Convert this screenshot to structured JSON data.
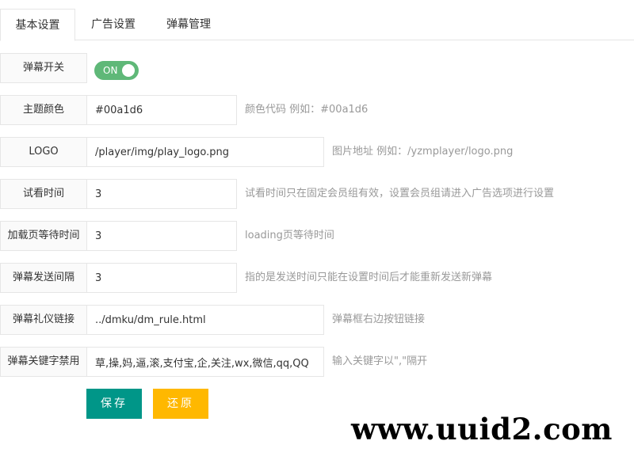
{
  "tabs": [
    {
      "label": "基本设置",
      "active": true
    },
    {
      "label": "广告设置",
      "active": false
    },
    {
      "label": "弹幕管理",
      "active": false
    }
  ],
  "form": {
    "danmaku_switch": {
      "label": "弹幕开关",
      "state_text": "ON",
      "on": true,
      "color": "#5fb878"
    },
    "theme_color": {
      "label": "主题颜色",
      "value": "#00a1d6",
      "hint": "颜色代码 例如：#00a1d6"
    },
    "logo": {
      "label": "LOGO",
      "value": "/player/img/play_logo.png",
      "hint": "图片地址 例如：/yzmplayer/logo.png"
    },
    "trial_time": {
      "label": "试看时间",
      "value": "3",
      "hint": "试看时间只在固定会员组有效，设置会员组请进入广告选项进行设置"
    },
    "loading_wait": {
      "label": "加载页等待时间",
      "value": "3",
      "hint": "loading页等待时间"
    },
    "send_interval": {
      "label": "弹幕发送间隔",
      "value": "3",
      "hint": "指的是发送时间只能在设置时间后才能重新发送新弹幕"
    },
    "etiquette_link": {
      "label": "弹幕礼仪链接",
      "value": "../dmku/dm_rule.html",
      "hint": "弹幕框右边按钮链接"
    },
    "banned_keywords": {
      "label": "弹幕关键字禁用",
      "value": "草,操,妈,逼,滚,支付宝,企,关注,wx,微信,qq,QQ",
      "hint": "输入关键字以\",\"隔开"
    }
  },
  "buttons": {
    "save": "保存",
    "reset": "还原"
  },
  "colors": {
    "save": "#009688",
    "reset": "#ffb800",
    "switch_on": "#5fb878"
  },
  "watermark": "www.uuid2.com"
}
